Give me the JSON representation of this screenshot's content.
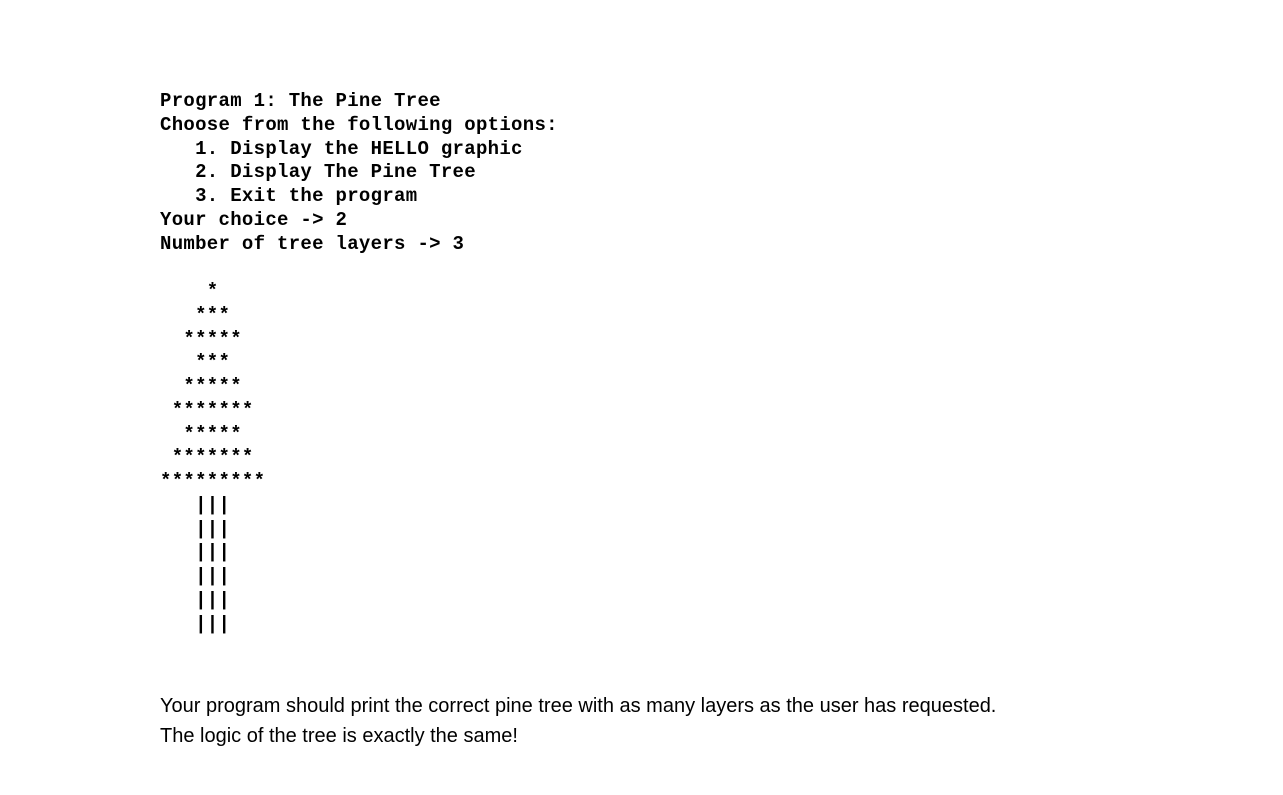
{
  "code": {
    "line1": "Program 1: The Pine Tree",
    "line2": "Choose from the following options:",
    "line3": "   1. Display the HELLO graphic",
    "line4": "   2. Display The Pine Tree",
    "line5": "   3. Exit the program",
    "line6": "Your choice -> 2",
    "line7": "Number of tree layers -> 3",
    "line8": "",
    "line9": "    *",
    "line10": "   ***",
    "line11": "  *****",
    "line12": "   ***",
    "line13": "  *****",
    "line14": " *******",
    "line15": "  *****",
    "line16": " *******",
    "line17": "*********",
    "line18": "   |||",
    "line19": "   |||",
    "line20": "   |||",
    "line21": "   |||",
    "line22": "   |||",
    "line23": "   |||"
  },
  "paragraph": {
    "line1": "Your program should print the correct pine tree with as many layers as the user has requested.",
    "line2": "The logic of the tree is exactly the same!"
  }
}
